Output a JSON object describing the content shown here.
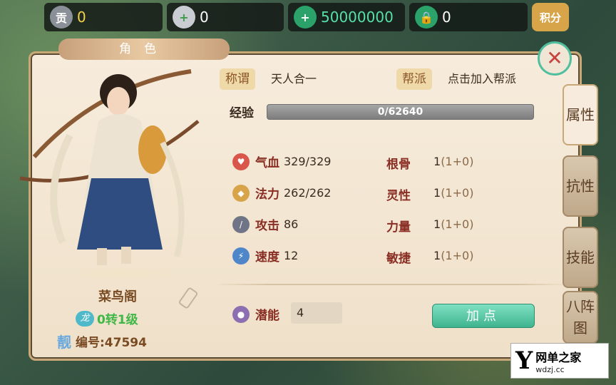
{
  "currencies": [
    {
      "icon": "贡",
      "value": "0",
      "icon_name": "tribute-coin-icon"
    },
    {
      "icon": "+",
      "value": "0",
      "icon_name": "silver-ingot-icon"
    },
    {
      "icon": "+",
      "value": "50000000",
      "icon_name": "jade-plus-icon"
    },
    {
      "icon": "🔒",
      "value": "0",
      "icon_name": "jade-locked-icon"
    }
  ],
  "score_label": "积分",
  "panel": {
    "title": "角色",
    "close_label": "✕"
  },
  "character": {
    "name": "菜鸟阁",
    "level_badge": "龙",
    "level": "0转1级",
    "id_badge": "靓",
    "id": "编号:47594"
  },
  "info": {
    "title_tag": "称谓",
    "title_value": "天人合一",
    "guild_tag": "帮派",
    "guild_value": "点击加入帮派",
    "exp_label": "经验",
    "exp_value": "0/62640",
    "exp_progress": 0
  },
  "stats": [
    {
      "label": "气血",
      "value": "329/329",
      "icon_name": "heart-icon",
      "color": "#d9564b"
    },
    {
      "label": "法力",
      "value": "262/262",
      "icon_name": "mana-icon",
      "color": "#d8a44a"
    },
    {
      "label": "攻击",
      "value": "86",
      "icon_name": "sword-icon",
      "color": "#6f7586"
    },
    {
      "label": "速度",
      "value": "12",
      "icon_name": "lightning-icon",
      "color": "#4f86c9"
    }
  ],
  "attributes": [
    {
      "label": "根骨",
      "value": "1",
      "bonus": "(1+0)"
    },
    {
      "label": "灵性",
      "value": "1",
      "bonus": "(1+0)"
    },
    {
      "label": "力量",
      "value": "1",
      "bonus": "(1+0)"
    },
    {
      "label": "敏捷",
      "value": "1",
      "bonus": "(1+0)"
    }
  ],
  "potential": {
    "label": "潜能",
    "value": "4",
    "button": "加点"
  },
  "tabs": [
    "属性",
    "抗性",
    "技能",
    "八阵图"
  ],
  "watermark": {
    "mark": "Y",
    "title": "网单之家",
    "url": "wdzj.cc"
  }
}
